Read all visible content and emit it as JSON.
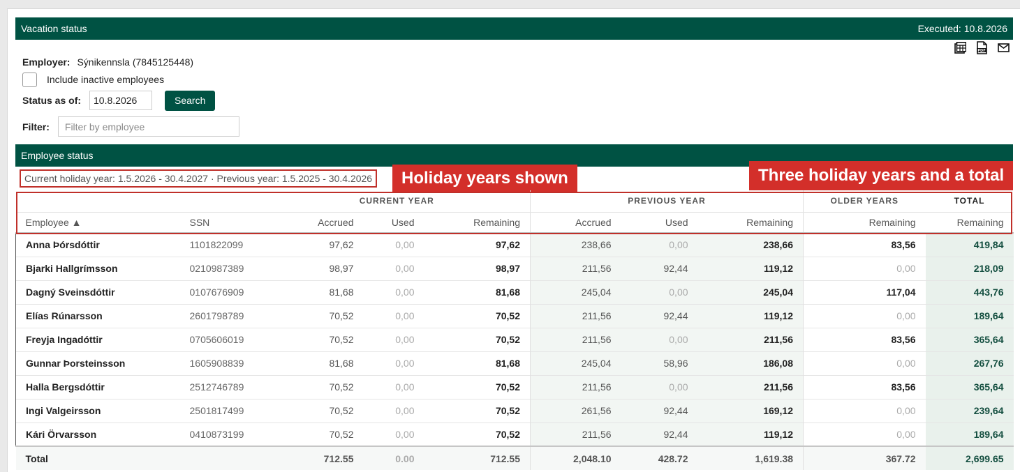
{
  "header": {
    "title": "Vacation status",
    "executed": "Executed: 10.8.2026"
  },
  "toolbar": {
    "icons": [
      "spreadsheet-icon",
      "pdf-icon",
      "mail-icon"
    ],
    "pdf_text": "PDF"
  },
  "employer": {
    "label": "Employer:",
    "value": "Sýnikennsla (7845125448)"
  },
  "inactive": {
    "label": "Include inactive employees",
    "checked": false
  },
  "status": {
    "label": "Status as of:",
    "value": "10.8.2026",
    "button": "Search"
  },
  "filter": {
    "label": "Filter:",
    "placeholder": "Filter by employee"
  },
  "section": {
    "title": "Employee status"
  },
  "years_info": "Current holiday year: 1.5.2026 - 30.4.2027 · Previous year: 1.5.2025 - 30.4.2026",
  "callouts": {
    "years": "Holiday years shown",
    "totals": "Three holiday years and a total"
  },
  "groups": {
    "current": "CURRENT YEAR",
    "previous": "PREVIOUS YEAR",
    "older": "OLDER YEARS",
    "total": "TOTAL"
  },
  "columns": {
    "employee": "Employee ▲",
    "ssn": "SSN",
    "cur_accrued": "Accrued",
    "cur_used": "Used",
    "cur_remaining": "Remaining",
    "prev_accrued": "Accrued",
    "prev_used": "Used",
    "prev_remaining": "Remaining",
    "older_remaining": "Remaining",
    "total_remaining": "Remaining"
  },
  "rows": [
    {
      "name": "Anna Þórsdóttir",
      "ssn": "1101822099",
      "ca": "97,62",
      "cu": "0,00",
      "cr": "97,62",
      "pa": "238,66",
      "pu": "0,00",
      "pr": "238,66",
      "or": "83,56",
      "tr": "419,84"
    },
    {
      "name": "Bjarki Hallgrímsson",
      "ssn": "0210987389",
      "ca": "98,97",
      "cu": "0,00",
      "cr": "98,97",
      "pa": "211,56",
      "pu": "92,44",
      "pr": "119,12",
      "or": "0,00",
      "tr": "218,09"
    },
    {
      "name": "Dagný Sveinsdóttir",
      "ssn": "0107676909",
      "ca": "81,68",
      "cu": "0,00",
      "cr": "81,68",
      "pa": "245,04",
      "pu": "0,00",
      "pr": "245,04",
      "or": "117,04",
      "tr": "443,76"
    },
    {
      "name": "Elías Rúnarsson",
      "ssn": "2601798789",
      "ca": "70,52",
      "cu": "0,00",
      "cr": "70,52",
      "pa": "211,56",
      "pu": "92,44",
      "pr": "119,12",
      "or": "0,00",
      "tr": "189,64"
    },
    {
      "name": "Freyja Ingadóttir",
      "ssn": "0705606019",
      "ca": "70,52",
      "cu": "0,00",
      "cr": "70,52",
      "pa": "211,56",
      "pu": "0,00",
      "pr": "211,56",
      "or": "83,56",
      "tr": "365,64"
    },
    {
      "name": "Gunnar Þorsteinsson",
      "ssn": "1605908839",
      "ca": "81,68",
      "cu": "0,00",
      "cr": "81,68",
      "pa": "245,04",
      "pu": "58,96",
      "pr": "186,08",
      "or": "0,00",
      "tr": "267,76"
    },
    {
      "name": "Halla Bergsdóttir",
      "ssn": "2512746789",
      "ca": "70,52",
      "cu": "0,00",
      "cr": "70,52",
      "pa": "211,56",
      "pu": "0,00",
      "pr": "211,56",
      "or": "83,56",
      "tr": "365,64"
    },
    {
      "name": "Ingi Valgeirsson",
      "ssn": "2501817499",
      "ca": "70,52",
      "cu": "0,00",
      "cr": "70,52",
      "pa": "261,56",
      "pu": "92,44",
      "pr": "169,12",
      "or": "0,00",
      "tr": "239,64"
    },
    {
      "name": "Kári Örvarsson",
      "ssn": "0410873199",
      "ca": "70,52",
      "cu": "0,00",
      "cr": "70,52",
      "pa": "211,56",
      "pu": "92,44",
      "pr": "119,12",
      "or": "0,00",
      "tr": "189,64"
    }
  ],
  "totals": {
    "label": "Total",
    "ca": "712.55",
    "cu": "0.00",
    "cr": "712.55",
    "pa": "2,048.10",
    "pu": "428.72",
    "pr": "1,619.38",
    "or": "367.72",
    "tr": "2,699.65"
  },
  "colors": {
    "brand": "#005243",
    "annotation": "#d32f2a"
  }
}
